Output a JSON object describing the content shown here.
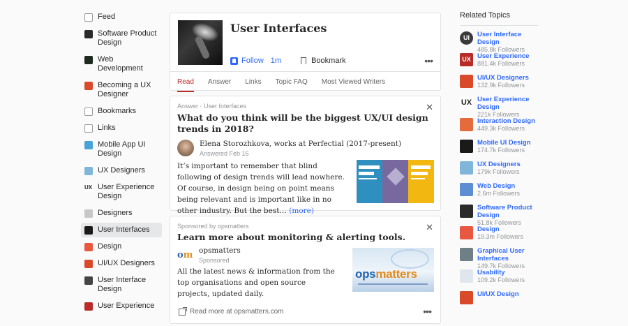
{
  "sidebar": {
    "items": [
      {
        "label": "Feed",
        "icon": "feed-icon",
        "color": "#e0e0e0"
      },
      {
        "label": "Software Product Design",
        "icon": "software-product-design-icon",
        "color": "#2a2a2a"
      },
      {
        "label": "Web Development",
        "icon": "web-development-icon",
        "color": "#1e2a1e"
      },
      {
        "label": "Becoming a UX Designer",
        "icon": "becoming-ux-designer-icon",
        "color": "#d94a2a"
      },
      {
        "label": "Bookmarks",
        "icon": "bookmarks-icon",
        "color": "#e0e0e0"
      },
      {
        "label": "Links",
        "icon": "links-icon",
        "color": "#e0e0e0"
      },
      {
        "label": "Mobile App UI Design",
        "icon": "mobile-app-ui-design-icon",
        "color": "#4aa3d8"
      },
      {
        "label": "UX Designers",
        "icon": "ux-designers-icon",
        "color": "#7fb6d9"
      },
      {
        "label": "User Experience Design",
        "icon": "user-experience-design-icon",
        "color": "#ffffff"
      },
      {
        "label": "Designers",
        "icon": "designers-icon",
        "color": "#c7c7c7"
      },
      {
        "label": "User Interfaces",
        "icon": "user-interfaces-icon",
        "color": "#1a1a1a",
        "active": true
      },
      {
        "label": "Design",
        "icon": "design-icon",
        "color": "#e8573f"
      },
      {
        "label": "UI/UX Designers",
        "icon": "ui-ux-designers-icon",
        "color": "#d94a2a"
      },
      {
        "label": "User Interface Design",
        "icon": "user-interface-design-icon",
        "color": "#444444"
      },
      {
        "label": "User Experience",
        "icon": "user-experience-icon",
        "color": "#b92b27"
      }
    ]
  },
  "topic": {
    "title": "User Interfaces",
    "follow_label": "Follow",
    "follow_count": "1m",
    "bookmark_label": "Bookmark",
    "more": "•••",
    "tabs": [
      "Read",
      "Answer",
      "Links",
      "Topic FAQ",
      "Most Viewed Writers"
    ]
  },
  "answer": {
    "meta": "Answer · User Interfaces",
    "close": "✕",
    "question": "What do you think will be the biggest UX/UI design trends in 2018?",
    "author": "Elena Storozhkova, works at Perfectial (2017-present)",
    "date": "Answered Feb 16",
    "text": "It’s important to remember that blind following of design trends will lead nowhere. Of course, in design being on point means being relevant and is important like in no other industry. But the best… ",
    "more_link": "(more)"
  },
  "sponsored": {
    "meta": "Sponsored by opsmatters",
    "close": "✕",
    "title": "Learn more about monitoring & alerting tools.",
    "brand": "opsmatters",
    "sub": "Sponsored",
    "logo_o": "o",
    "logo_m": "m",
    "text": "All the latest news & information from the top organisations and open source projects, updated daily.",
    "image_wordmark_a": "ops",
    "image_wordmark_b": "matters",
    "read_more": "Read more at opsmatters.com",
    "more": "•••"
  },
  "related": {
    "heading": "Related Topics",
    "items": [
      {
        "name": "User Interface Design",
        "followers": "485.8k Followers",
        "icon": "user-interface-design-icon",
        "color": "#3a3a3a",
        "glyph": "UI"
      },
      {
        "name": "User Experience",
        "followers": "881.4k Followers",
        "icon": "user-experience-icon",
        "color": "#b92b27",
        "glyph": "UX"
      },
      {
        "name": "UI/UX Designers",
        "followers": "132.9k Followers",
        "icon": "ui-ux-designers-icon",
        "color": "#d94a2a",
        "glyph": ""
      },
      {
        "name": "User Experience Design",
        "followers": "221k Followers",
        "icon": "user-experience-design-icon",
        "color": "#ffffff",
        "glyph": "UX"
      },
      {
        "name": "Interaction Design",
        "followers": "449.3k Followers",
        "icon": "interaction-design-icon",
        "color": "#e46c3c",
        "glyph": ""
      },
      {
        "name": "Mobile UI Design",
        "followers": "174.7k Followers",
        "icon": "mobile-ui-design-icon",
        "color": "#1a1a1a",
        "glyph": ""
      },
      {
        "name": "UX Designers",
        "followers": "179k Followers",
        "icon": "ux-designers-icon",
        "color": "#7fb6d9",
        "glyph": ""
      },
      {
        "name": "Web Design",
        "followers": "2.6m Followers",
        "icon": "web-design-icon",
        "color": "#5c8ed1",
        "glyph": ""
      },
      {
        "name": "Software Product Design",
        "followers": "51.8k Followers",
        "icon": "software-product-design-icon",
        "color": "#2a2a2a",
        "glyph": ""
      },
      {
        "name": "Design",
        "followers": "19.3m Followers",
        "icon": "design-icon",
        "color": "#e8573f",
        "glyph": ""
      },
      {
        "name": "Graphical User Interfaces",
        "followers": "149.7k Followers",
        "icon": "graphical-user-interfaces-icon",
        "color": "#6f7f86",
        "glyph": ""
      },
      {
        "name": "Usability",
        "followers": "109.2k Followers",
        "icon": "usability-icon",
        "color": "#dfe6ee",
        "glyph": ""
      },
      {
        "name": "UI/UX Design",
        "followers": "",
        "icon": "ui-ux-design-icon",
        "color": "#d94a2a",
        "glyph": ""
      }
    ]
  }
}
